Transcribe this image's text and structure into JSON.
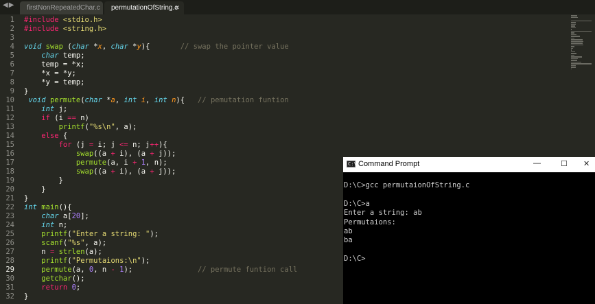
{
  "tabs": [
    {
      "label": "firstNonRepeatedChar.c",
      "active": false
    },
    {
      "label": "permutationOfString.c",
      "active": true
    }
  ],
  "nav_icons": [
    "back-arrow-icon",
    "forward-arrow-icon"
  ],
  "highlighted_line": 29,
  "code_lines": [
    [
      [
        "kw",
        "#include"
      ],
      [
        "",
        " "
      ],
      [
        "str",
        "<stdio.h>"
      ]
    ],
    [
      [
        "kw",
        "#include"
      ],
      [
        "",
        " "
      ],
      [
        "str",
        "<string.h>"
      ]
    ],
    [],
    [
      [
        "ty",
        "void"
      ],
      [
        "",
        " "
      ],
      [
        "fn",
        "swap"
      ],
      [
        "",
        " ("
      ],
      [
        "ty",
        "char"
      ],
      [
        "",
        " *"
      ],
      [
        "pm",
        "x"
      ],
      [
        "",
        ", "
      ],
      [
        "ty",
        "char"
      ],
      [
        "",
        " *"
      ],
      [
        "pm",
        "y"
      ],
      [
        "",
        "){       "
      ],
      [
        "cm",
        "// swap the pointer value"
      ]
    ],
    [
      [
        "",
        "    "
      ],
      [
        "ty",
        "char"
      ],
      [
        "",
        " temp;"
      ]
    ],
    [
      [
        "",
        "    temp = *x;"
      ]
    ],
    [
      [
        "",
        "    *x = *y;"
      ]
    ],
    [
      [
        "",
        "    *y = temp;"
      ]
    ],
    [
      [
        "",
        "}"
      ]
    ],
    [
      [
        "",
        " "
      ],
      [
        "ty",
        "void"
      ],
      [
        "",
        " "
      ],
      [
        "fn",
        "permute"
      ],
      [
        "",
        "("
      ],
      [
        "ty",
        "char"
      ],
      [
        "",
        " *"
      ],
      [
        "pm",
        "a"
      ],
      [
        "",
        ", "
      ],
      [
        "ty",
        "int"
      ],
      [
        "",
        " "
      ],
      [
        "pm",
        "i"
      ],
      [
        "",
        ", "
      ],
      [
        "ty",
        "int"
      ],
      [
        "",
        " "
      ],
      [
        "pm",
        "n"
      ],
      [
        "",
        "){   "
      ],
      [
        "cm",
        "// pemutation funtion"
      ]
    ],
    [
      [
        "",
        "    "
      ],
      [
        "ty",
        "int"
      ],
      [
        "",
        " j;"
      ]
    ],
    [
      [
        "",
        "    "
      ],
      [
        "kw",
        "if"
      ],
      [
        "",
        " (i "
      ],
      [
        "kw",
        "=="
      ],
      [
        "",
        " n)"
      ]
    ],
    [
      [
        "",
        "        "
      ],
      [
        "fn",
        "printf"
      ],
      [
        "",
        "("
      ],
      [
        "str",
        "\"%s\\n\""
      ],
      [
        "",
        ", a);"
      ]
    ],
    [
      [
        "",
        "    "
      ],
      [
        "kw",
        "else"
      ],
      [
        "",
        " {"
      ]
    ],
    [
      [
        "",
        "        "
      ],
      [
        "kw",
        "for"
      ],
      [
        "",
        " (j "
      ],
      [
        "kw",
        "="
      ],
      [
        "",
        " i; j "
      ],
      [
        "kw",
        "<="
      ],
      [
        "",
        " n; j"
      ],
      [
        "kw",
        "++"
      ],
      [
        "",
        "){"
      ]
    ],
    [
      [
        "",
        "            "
      ],
      [
        "fn",
        "swap"
      ],
      [
        "",
        "((a "
      ],
      [
        "kw",
        "+"
      ],
      [
        "",
        " i), (a "
      ],
      [
        "kw",
        "+"
      ],
      [
        "",
        " j));"
      ]
    ],
    [
      [
        "",
        "            "
      ],
      [
        "fn",
        "permute"
      ],
      [
        "",
        "(a, i "
      ],
      [
        "kw",
        "+"
      ],
      [
        "",
        " "
      ],
      [
        "num",
        "1"
      ],
      [
        "",
        ", n);"
      ]
    ],
    [
      [
        "",
        "            "
      ],
      [
        "fn",
        "swap"
      ],
      [
        "",
        "((a "
      ],
      [
        "kw",
        "+"
      ],
      [
        "",
        " i), (a "
      ],
      [
        "kw",
        "+"
      ],
      [
        "",
        " j));"
      ]
    ],
    [
      [
        "",
        "        }"
      ]
    ],
    [
      [
        "",
        "    }"
      ]
    ],
    [
      [
        "",
        "}"
      ]
    ],
    [
      [
        "ty",
        "int"
      ],
      [
        "",
        " "
      ],
      [
        "fn",
        "main"
      ],
      [
        "",
        "(){"
      ]
    ],
    [
      [
        "",
        "    "
      ],
      [
        "ty",
        "char"
      ],
      [
        "",
        " a["
      ],
      [
        "num",
        "20"
      ],
      [
        "",
        "];"
      ]
    ],
    [
      [
        "",
        "    "
      ],
      [
        "ty",
        "int"
      ],
      [
        "",
        " n;"
      ]
    ],
    [
      [
        "",
        "    "
      ],
      [
        "fn",
        "printf"
      ],
      [
        "",
        "("
      ],
      [
        "str",
        "\"Enter a string: \""
      ],
      [
        "",
        ");"
      ]
    ],
    [
      [
        "",
        "    "
      ],
      [
        "fn",
        "scanf"
      ],
      [
        "",
        "("
      ],
      [
        "str",
        "\"%s\""
      ],
      [
        "",
        ", a);"
      ]
    ],
    [
      [
        "",
        "    n "
      ],
      [
        "kw",
        "="
      ],
      [
        "",
        " "
      ],
      [
        "fn",
        "strlen"
      ],
      [
        "",
        "(a);"
      ]
    ],
    [
      [
        "",
        "    "
      ],
      [
        "fn",
        "printf"
      ],
      [
        "",
        "("
      ],
      [
        "str",
        "\"Permutaions:\\n\""
      ],
      [
        "",
        ");"
      ]
    ],
    [
      [
        "",
        "    "
      ],
      [
        "fn",
        "permute"
      ],
      [
        "",
        "(a, "
      ],
      [
        "num",
        "0"
      ],
      [
        "",
        ", n "
      ],
      [
        "kw",
        "-"
      ],
      [
        "",
        " "
      ],
      [
        "num",
        "1"
      ],
      [
        "",
        "); "
      ],
      [
        "",
        "              "
      ],
      [
        "cm",
        "// permute funtion call"
      ]
    ],
    [
      [
        "",
        "    "
      ],
      [
        "fn",
        "getchar"
      ],
      [
        "",
        "();"
      ]
    ],
    [
      [
        "",
        "    "
      ],
      [
        "kw",
        "return"
      ],
      [
        "",
        " "
      ],
      [
        "num",
        "0"
      ],
      [
        "",
        ";"
      ]
    ],
    [
      [
        "",
        "}"
      ]
    ]
  ],
  "cmd_window": {
    "title": "Command Prompt",
    "icon": "cmd-app-icon",
    "buttons": {
      "minimize": "—",
      "maximize": "☐",
      "close": "✕"
    },
    "output_lines": [
      "D:\\C>gcc permutaionOfString.c",
      "",
      "D:\\C>a",
      "Enter a string: ab",
      "Permutaions:",
      "ab",
      "ba",
      "",
      "D:\\C>"
    ]
  },
  "colors": {
    "editor_bg": "#272822",
    "tab_bar_bg": "#1d1e19",
    "keyword": "#f92672",
    "type": "#66d9ef",
    "function": "#a6e22e",
    "string": "#e6db74",
    "number": "#ae81ff",
    "comment": "#75715e",
    "param": "#fd971f",
    "console_bg": "#000000"
  }
}
